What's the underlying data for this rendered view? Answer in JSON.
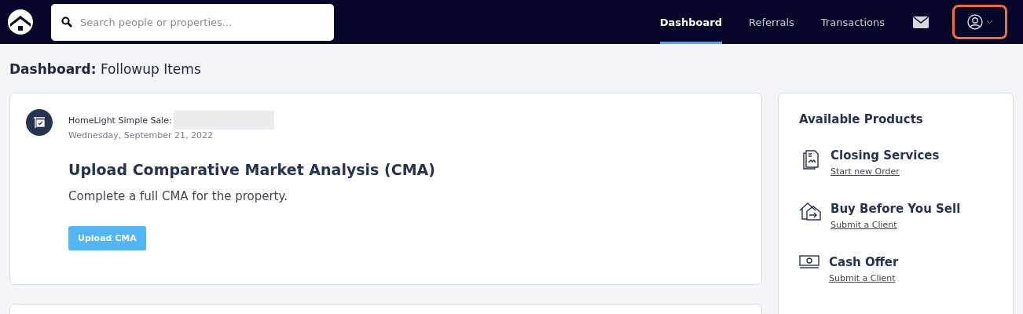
{
  "nav": {
    "search": {
      "placeholder": "Search people or properties..."
    },
    "tabs": [
      {
        "label": "Dashboard",
        "selected": true
      },
      {
        "label": "Referrals",
        "selected": false
      },
      {
        "label": "Transactions",
        "selected": false
      }
    ],
    "user_menu": {
      "highlighted": true
    }
  },
  "page_title": {
    "section": "Dashboard:",
    "title": "Followup Items"
  },
  "tasks": [
    {
      "source": "HomeLight Simple Sale:",
      "date": "Wednesday, September 21, 2022",
      "title": "Upload Comparative Market Analysis (CMA)",
      "description": "Complete a full CMA for the property.",
      "action": "Upload CMA"
    }
  ],
  "products": {
    "title": "Available Products",
    "items": [
      {
        "kind": "closing",
        "name": "Closing Services",
        "link": "Start new Order"
      },
      {
        "kind": "buy-before-sell",
        "name": "Buy Before You Sell",
        "link": "Submit a Client"
      },
      {
        "kind": "cash",
        "name": "Cash Offer",
        "link": "Submit a Client"
      }
    ]
  }
}
